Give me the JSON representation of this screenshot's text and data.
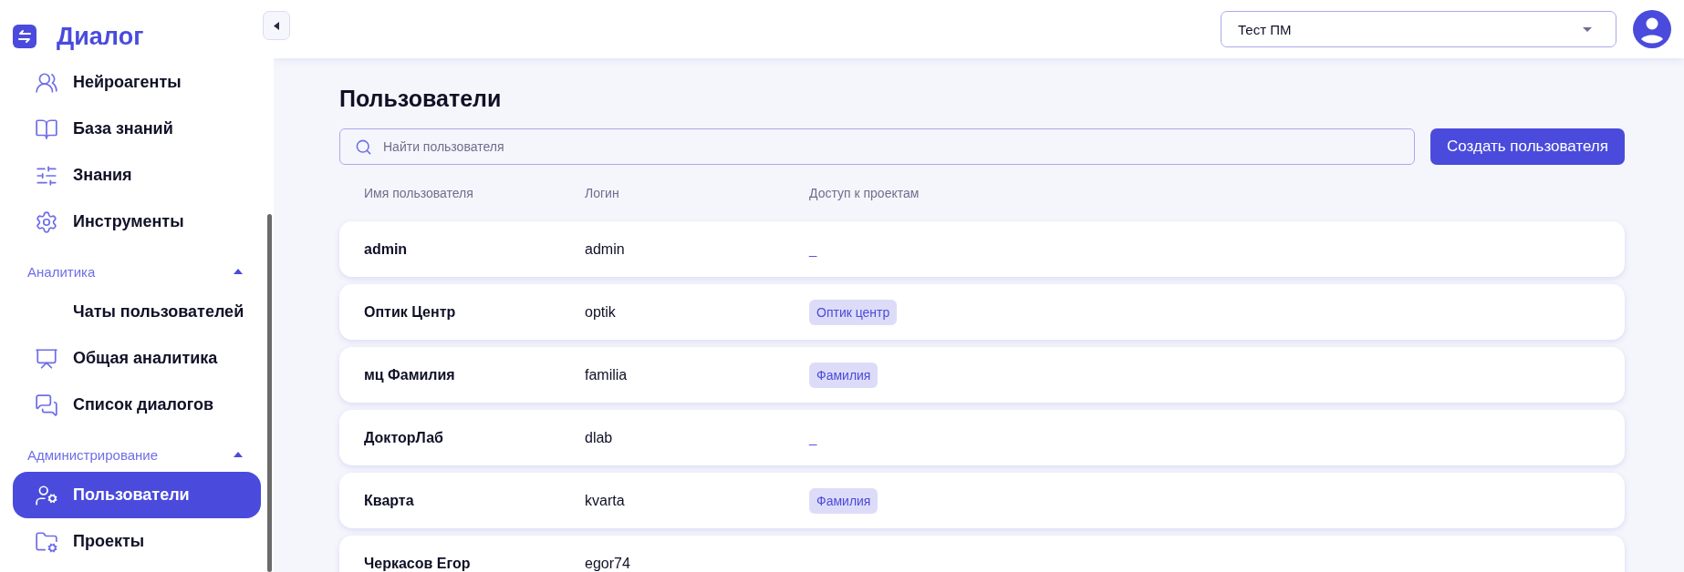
{
  "sidebar": {
    "logo": "Диалог",
    "sections": [
      {
        "items": [
          {
            "label": "Нейроагенты",
            "selected": false
          },
          {
            "label": "База знаний",
            "selected": false
          },
          {
            "label": "Знания",
            "selected": false
          },
          {
            "label": "Инструменты",
            "selected": false
          }
        ]
      },
      {
        "title": "Аналитика",
        "expanded": true,
        "items": [
          {
            "label": "Чаты пользователей",
            "selected": false
          },
          {
            "label": "Общая аналитика",
            "selected": false
          },
          {
            "label": "Список диалогов",
            "selected": false
          }
        ]
      },
      {
        "title": "Администрирование",
        "expanded": true,
        "items": [
          {
            "label": "Пользователи",
            "selected": true
          },
          {
            "label": "Проекты",
            "selected": false
          }
        ]
      }
    ]
  },
  "header": {
    "project_select": "Тест ПМ"
  },
  "page": {
    "title": "Пользователи",
    "search": {
      "placeholder": "Найти пользователя"
    },
    "create_button": "Создать пользователя"
  },
  "table": {
    "columns": [
      "Имя пользователя",
      "Логин",
      "Доступ к проектам"
    ],
    "rows": [
      {
        "name": "admin",
        "login": "admin",
        "access": {
          "kind": "none",
          "text": "_"
        }
      },
      {
        "name": "Оптик Центр",
        "login": "optik",
        "access": {
          "kind": "tag",
          "text": "Оптик центр"
        }
      },
      {
        "name": "мц Фамилия",
        "login": "familia",
        "access": {
          "kind": "tag",
          "text": "Фамилия"
        }
      },
      {
        "name": "ДокторЛаб",
        "login": "dlab",
        "access": {
          "kind": "none",
          "text": "_"
        }
      },
      {
        "name": "Кварта",
        "login": "kvarta",
        "access": {
          "kind": "tag",
          "text": "Фамилия"
        }
      },
      {
        "name": "Черкасов Егор",
        "login": "egor74"
      }
    ]
  }
}
